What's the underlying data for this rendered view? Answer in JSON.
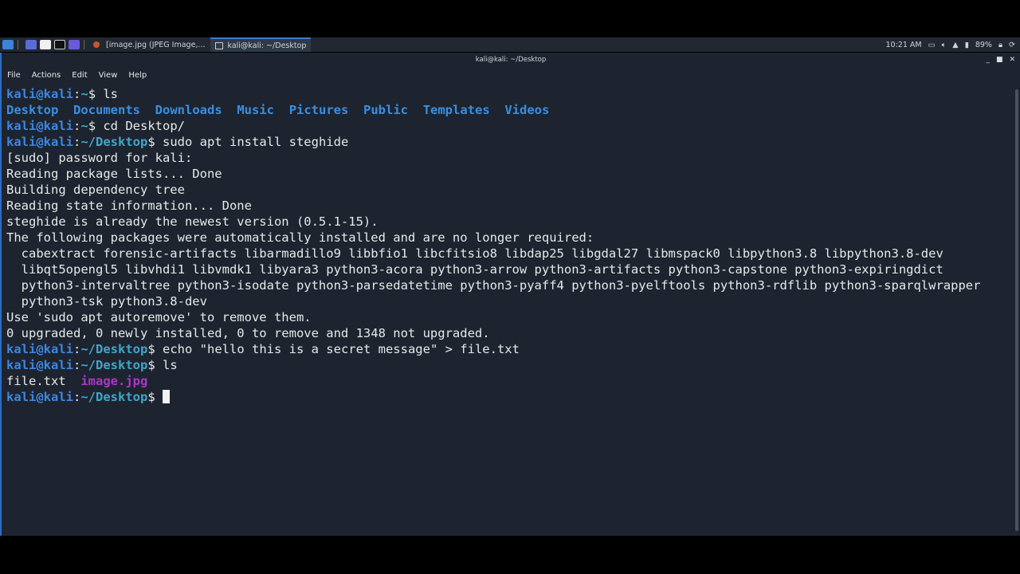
{
  "taskbar": {
    "tasks": [
      "[image.jpg (JPEG Image,...",
      "kali@kali: ~/Desktop"
    ],
    "clock": "10:21 AM",
    "battery": "89%"
  },
  "window": {
    "title": "kali@kali: ~/Desktop",
    "menu": [
      "File",
      "Actions",
      "Edit",
      "View",
      "Help"
    ]
  },
  "colors": {
    "user": "#3f86e0",
    "path": "#41a6c9",
    "dir": "#3a8fe0",
    "image": "#a838c4",
    "text": "#e8e8e8"
  },
  "terminal": {
    "lines": [
      [
        {
          "t": "kali@kali",
          "c": "user",
          "b": 1
        },
        {
          "t": ":",
          "c": "text"
        },
        {
          "t": "~",
          "c": "path",
          "b": 1
        },
        {
          "t": "$ ls",
          "c": "text"
        }
      ],
      [
        {
          "t": "Desktop",
          "c": "dir",
          "b": 1
        },
        {
          "t": "  "
        },
        {
          "t": "Documents",
          "c": "dir",
          "b": 1
        },
        {
          "t": "  "
        },
        {
          "t": "Downloads",
          "c": "dir",
          "b": 1
        },
        {
          "t": "  "
        },
        {
          "t": "Music",
          "c": "dir",
          "b": 1
        },
        {
          "t": "  "
        },
        {
          "t": "Pictures",
          "c": "dir",
          "b": 1
        },
        {
          "t": "  "
        },
        {
          "t": "Public",
          "c": "dir",
          "b": 1
        },
        {
          "t": "  "
        },
        {
          "t": "Templates",
          "c": "dir",
          "b": 1
        },
        {
          "t": "  "
        },
        {
          "t": "Videos",
          "c": "dir",
          "b": 1
        }
      ],
      [
        {
          "t": "kali@kali",
          "c": "user",
          "b": 1
        },
        {
          "t": ":",
          "c": "text"
        },
        {
          "t": "~",
          "c": "path",
          "b": 1
        },
        {
          "t": "$ cd Desktop/",
          "c": "text"
        }
      ],
      [
        {
          "t": "kali@kali",
          "c": "user",
          "b": 1
        },
        {
          "t": ":",
          "c": "text"
        },
        {
          "t": "~/Desktop",
          "c": "path",
          "b": 1
        },
        {
          "t": "$ sudo apt install steghide",
          "c": "text"
        }
      ],
      [
        {
          "t": "[sudo] password for kali:"
        }
      ],
      [
        {
          "t": "Reading package lists... Done"
        }
      ],
      [
        {
          "t": "Building dependency tree"
        }
      ],
      [
        {
          "t": "Reading state information... Done"
        }
      ],
      [
        {
          "t": "steghide is already the newest version (0.5.1-15)."
        }
      ],
      [
        {
          "t": "The following packages were automatically installed and are no longer required:"
        }
      ],
      [
        {
          "t": "  cabextract forensic-artifacts libarmadillo9 libbfio1 libcfitsio8 libdap25 libgdal27 libmspack0 libpython3.8 libpython3.8-dev"
        }
      ],
      [
        {
          "t": "  libqt5opengl5 libvhdi1 libvmdk1 libyara3 python3-acora python3-arrow python3-artifacts python3-capstone python3-expiringdict"
        }
      ],
      [
        {
          "t": "  python3-intervaltree python3-isodate python3-parsedatetime python3-pyaff4 python3-pyelftools python3-rdflib python3-sparqlwrapper"
        }
      ],
      [
        {
          "t": "  python3-tsk python3.8-dev"
        }
      ],
      [
        {
          "t": "Use 'sudo apt autoremove' to remove them."
        }
      ],
      [
        {
          "t": "0 upgraded, 0 newly installed, 0 to remove and 1348 not upgraded."
        }
      ],
      [
        {
          "t": "kali@kali",
          "c": "user",
          "b": 1
        },
        {
          "t": ":",
          "c": "text"
        },
        {
          "t": "~/Desktop",
          "c": "path",
          "b": 1
        },
        {
          "t": "$ echo \"hello this is a secret message\" > file.txt",
          "c": "text"
        }
      ],
      [
        {
          "t": "kali@kali",
          "c": "user",
          "b": 1
        },
        {
          "t": ":",
          "c": "text"
        },
        {
          "t": "~/Desktop",
          "c": "path",
          "b": 1
        },
        {
          "t": "$ ls",
          "c": "text"
        }
      ],
      [
        {
          "t": "file.txt  "
        },
        {
          "t": "image.jpg",
          "c": "image",
          "b": 1
        }
      ],
      [
        {
          "t": "kali@kali",
          "c": "user",
          "b": 1
        },
        {
          "t": ":",
          "c": "text"
        },
        {
          "t": "~/Desktop",
          "c": "path",
          "b": 1
        },
        {
          "t": "$ ",
          "c": "text"
        }
      ]
    ]
  }
}
